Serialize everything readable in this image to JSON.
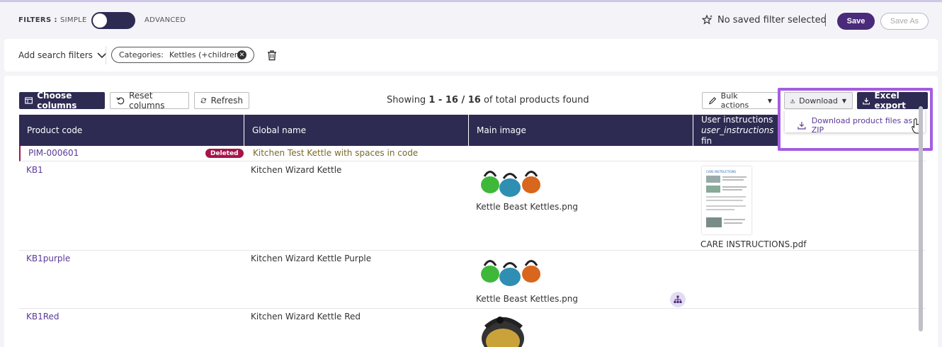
{
  "filters": {
    "label": "FILTERS :",
    "simple": "SIMPLE",
    "advanced": "ADVANCED",
    "mode": "simple",
    "saved_filter_text": "No saved filter selected",
    "save": "Save",
    "save_as": "Save As"
  },
  "search": {
    "add_filters": "Add search filters",
    "chip_label": "Categories:",
    "chip_value": "Kettles (+children)"
  },
  "toolbar": {
    "choose_columns": "Choose columns",
    "reset_columns": "Reset columns",
    "refresh": "Refresh",
    "showing_prefix": "Showing",
    "showing_range": "1 - 16 / 16",
    "showing_suffix": "of total products found",
    "bulk_actions": "Bulk actions",
    "download": "Download",
    "excel_export": "Excel export",
    "download_menu_item": "Download product files as ZIP"
  },
  "table": {
    "columns": {
      "product_code": "Product code",
      "global_name": "Global name",
      "main_image": "Main image",
      "user_instructions_1": "User instructions",
      "user_instructions_2": "user_instructions",
      "user_instructions_3": "fin"
    },
    "rows": [
      {
        "code": "PIM-000601",
        "badge": "Deleted",
        "name": "Kitchen Test Kettle with spaces in code",
        "image": "",
        "doc": ""
      },
      {
        "code": "KB1",
        "name": "Kitchen Wizard Kettle",
        "image": "Kettle Beast Kettles.png",
        "doc": "CARE INSTRUCTIONS.pdf"
      },
      {
        "code": "KB1purple",
        "name": "Kitchen Wizard Kettle Purple",
        "image": "Kettle Beast Kettles.png",
        "doc": ""
      },
      {
        "code": "KB1Red",
        "name": "Kitchen Wizard Kettle Red",
        "image": "",
        "doc": ""
      }
    ],
    "doc_thumb_title": "CARE INSTRUCTIONS"
  },
  "colors": {
    "brand": "#2d2b52",
    "primary": "#4a2a7a",
    "link": "#5a3a9a",
    "highlight": "#a45de0",
    "deleted": "#a5154a"
  }
}
